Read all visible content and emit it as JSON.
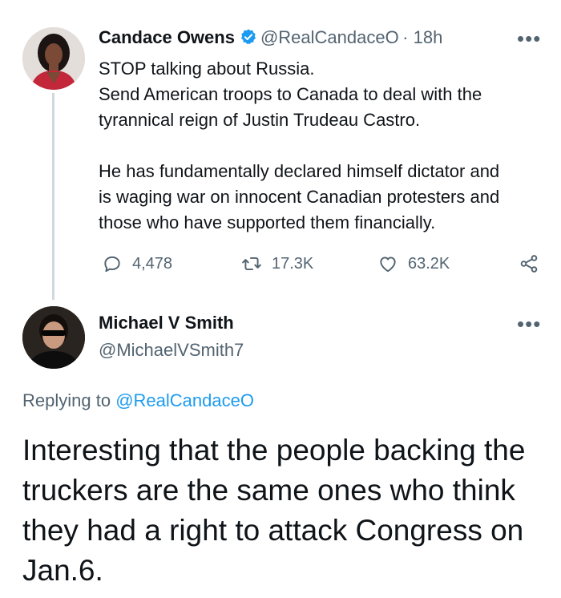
{
  "tweet": {
    "author_name": "Candace Owens",
    "author_handle": "@RealCandaceO",
    "time": "· 18h",
    "text_lines": [
      "STOP talking about Russia.",
      "Send American troops to Canada to deal with the",
      "tyrannical reign of Justin Trudeau Castro.",
      "He has fundamentally declared himself dictator and",
      "is waging war on innocent Canadian protesters and",
      "those who have supported them financially."
    ],
    "actions": {
      "replies": "4,478",
      "retweets": "17.3K",
      "likes": "63.2K"
    }
  },
  "reply": {
    "author_name": "Michael V Smith",
    "author_handle": "@MichaelVSmith7",
    "replying_prefix": "Replying to",
    "replying_handle": "@RealCandaceO",
    "text_lines": [
      "Interesting that the people backing the",
      "truckers are the same ones who think",
      "they had a right to attack Congress on",
      "Jan.6."
    ]
  },
  "colors": {
    "text": "#0f1419",
    "muted": "#536471",
    "link": "#1d9bf0",
    "verified": "#1d9bf0",
    "thread_line": "#cfd9de"
  },
  "icons": [
    "verified-badge-icon",
    "more-icon",
    "reply-icon",
    "retweet-icon",
    "like-icon",
    "share-icon"
  ]
}
